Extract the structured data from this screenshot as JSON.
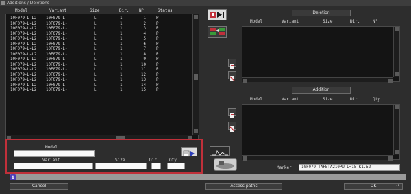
{
  "window": {
    "title": "Additions / Deletions"
  },
  "main_list": {
    "columns": [
      "Model",
      "Variant",
      "Size",
      "Dir.",
      "N°",
      "Status"
    ],
    "rows": [
      [
        "10F079-L-L2",
        "10F079-L-",
        "L",
        "1",
        "1",
        "P"
      ],
      [
        "10F079-L-L2",
        "10F079-L-",
        "L",
        "1",
        "2",
        "P"
      ],
      [
        "10F079-L-L2",
        "10F079-L-",
        "L",
        "1",
        "3",
        "P"
      ],
      [
        "10F079-L-L2",
        "10F079-L-",
        "L",
        "1",
        "4",
        "P"
      ],
      [
        "10F079-L-L2",
        "10F079-L-",
        "L",
        "1",
        "5",
        "P"
      ],
      [
        "10F079-L-L2",
        "10F079-L-",
        "L",
        "1",
        "6",
        "P"
      ],
      [
        "10F079-L-L2",
        "10F079-L-",
        "L",
        "1",
        "7",
        "P"
      ],
      [
        "10F079-L-L2",
        "10F079-L-",
        "L",
        "1",
        "8",
        "P"
      ],
      [
        "10F079-L-L2",
        "10F079-L-",
        "L",
        "1",
        "9",
        "P"
      ],
      [
        "10F079-L-L2",
        "10F079-L-",
        "L",
        "1",
        "10",
        "P"
      ],
      [
        "10F079-L-L2",
        "10F079-L-",
        "L",
        "1",
        "11",
        "P"
      ],
      [
        "10F079-L-L2",
        "10F079-L-",
        "L",
        "1",
        "12",
        "P"
      ],
      [
        "10F079-L-L2",
        "10F079-L-",
        "L",
        "1",
        "13",
        "P"
      ],
      [
        "10F079-L-L2",
        "10F079-L-",
        "L",
        "1",
        "14",
        "P"
      ],
      [
        "10F079-L-L2",
        "10F079-L-",
        "L",
        "1",
        "15",
        "P"
      ]
    ]
  },
  "deletion": {
    "title": "Deletion",
    "columns": [
      "Model",
      "Variant",
      "Size",
      "Dir.",
      "N°"
    ]
  },
  "addition": {
    "title": "Addition",
    "columns": [
      "Model",
      "Variant",
      "Size",
      "Dir.",
      "Qty"
    ]
  },
  "form": {
    "model_label": "Model",
    "variant_label": "Variant",
    "size_label": "Size",
    "dir_label": "Dir.",
    "qty_label": "Qty",
    "model_value": "",
    "variant_value": "",
    "size_value": "",
    "dir_value": "",
    "qty_value": ""
  },
  "marker": {
    "label": "Marker",
    "value": "10F079-TAFETA210PU-L=15-K1.52"
  },
  "buttons": {
    "cancel": "Cancel",
    "access_paths": "Access paths",
    "ok": "OK"
  },
  "icons": {
    "status_info": "info-icon",
    "colors": {
      "highlight": "#c0303a",
      "info": "#4c3db8"
    }
  }
}
